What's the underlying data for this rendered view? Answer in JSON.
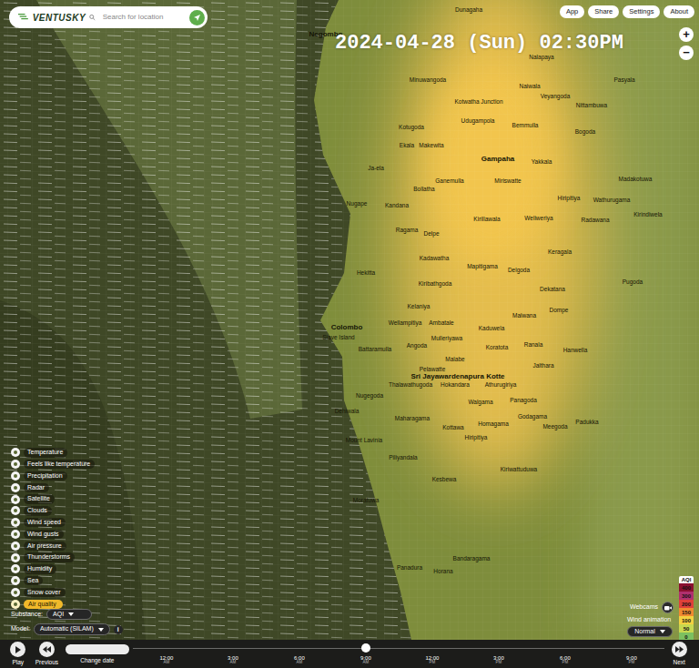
{
  "header": {
    "logo": "VENTUSKY",
    "search": {
      "placeholder": "Search for location"
    }
  },
  "top_buttons": [
    "App",
    "Share",
    "Settings",
    "About"
  ],
  "timestamp": "2024-04-28 (Sun) 02:30PM",
  "zoom": {
    "in": "+",
    "out": "−"
  },
  "places": [
    {
      "name": "Dunagaha",
      "kind": "minor"
    },
    {
      "name": "Negombo",
      "kind": "major"
    },
    {
      "name": "Nalapaya",
      "kind": "minor"
    },
    {
      "name": "Pasyala",
      "kind": "minor"
    },
    {
      "name": "Minuwangoda",
      "kind": "minor"
    },
    {
      "name": "Naiwala",
      "kind": "minor"
    },
    {
      "name": "Veyangoda",
      "kind": "minor"
    },
    {
      "name": "Kotwatha Junction",
      "kind": "minor"
    },
    {
      "name": "Nittambuwa",
      "kind": "minor"
    },
    {
      "name": "Udugampola",
      "kind": "minor"
    },
    {
      "name": "Bemmulla",
      "kind": "minor"
    },
    {
      "name": "Kotugoda",
      "kind": "minor"
    },
    {
      "name": "Bogoda",
      "kind": "minor"
    },
    {
      "name": "Ekala",
      "kind": "minor"
    },
    {
      "name": "Makewita",
      "kind": "minor"
    },
    {
      "name": "Gampaha",
      "kind": "major"
    },
    {
      "name": "Yakkala",
      "kind": "minor"
    },
    {
      "name": "Ja-ela",
      "kind": "minor"
    },
    {
      "name": "Madakotuwa",
      "kind": "minor"
    },
    {
      "name": "Ganemulla",
      "kind": "minor"
    },
    {
      "name": "Miriswatte",
      "kind": "minor"
    },
    {
      "name": "Bollatha",
      "kind": "minor"
    },
    {
      "name": "Hiripitiya",
      "kind": "minor"
    },
    {
      "name": "Wathurugama",
      "kind": "minor"
    },
    {
      "name": "Nugape",
      "kind": "minor"
    },
    {
      "name": "Kandana",
      "kind": "minor"
    },
    {
      "name": "Kirindiwela",
      "kind": "minor"
    },
    {
      "name": "Weliweriya",
      "kind": "minor"
    },
    {
      "name": "Kirillawala",
      "kind": "minor"
    },
    {
      "name": "Radawana",
      "kind": "minor"
    },
    {
      "name": "Ragama",
      "kind": "minor"
    },
    {
      "name": "Delpe",
      "kind": "minor"
    },
    {
      "name": "Keragala",
      "kind": "minor"
    },
    {
      "name": "Kadawatha",
      "kind": "minor"
    },
    {
      "name": "Mapitigama",
      "kind": "minor"
    },
    {
      "name": "Delgoda",
      "kind": "minor"
    },
    {
      "name": "Hekitta",
      "kind": "minor"
    },
    {
      "name": "Pugoda",
      "kind": "minor"
    },
    {
      "name": "Kiribathgoda",
      "kind": "minor"
    },
    {
      "name": "Dekatana",
      "kind": "minor"
    },
    {
      "name": "Kelaniya",
      "kind": "minor"
    },
    {
      "name": "Dompe",
      "kind": "minor"
    },
    {
      "name": "Wellampitiya",
      "kind": "minor"
    },
    {
      "name": "Ambatale",
      "kind": "minor"
    },
    {
      "name": "Colombo",
      "kind": "major"
    },
    {
      "name": "Kaduwela",
      "kind": "minor"
    },
    {
      "name": "Malwana",
      "kind": "minor"
    },
    {
      "name": "Slave Island",
      "kind": "minor"
    },
    {
      "name": "Mulleriyawa",
      "kind": "minor"
    },
    {
      "name": "Ranala",
      "kind": "minor"
    },
    {
      "name": "Koratota",
      "kind": "minor"
    },
    {
      "name": "Angoda",
      "kind": "minor"
    },
    {
      "name": "Battaramulla",
      "kind": "minor"
    },
    {
      "name": "Hanwella",
      "kind": "minor"
    },
    {
      "name": "Malabe",
      "kind": "minor"
    },
    {
      "name": "Jalthara",
      "kind": "minor"
    },
    {
      "name": "Pelawatte",
      "kind": "minor"
    },
    {
      "name": "Sri Jayawardenapura Kotte",
      "kind": "major"
    },
    {
      "name": "Thalawathugoda",
      "kind": "minor"
    },
    {
      "name": "Hokandara",
      "kind": "minor"
    },
    {
      "name": "Athurugiriya",
      "kind": "minor"
    },
    {
      "name": "Nugegoda",
      "kind": "minor"
    },
    {
      "name": "Panagoda",
      "kind": "minor"
    },
    {
      "name": "Walgama",
      "kind": "minor"
    },
    {
      "name": "Dehiwala",
      "kind": "minor"
    },
    {
      "name": "Godagama",
      "kind": "minor"
    },
    {
      "name": "Maharagama",
      "kind": "minor"
    },
    {
      "name": "Padukka",
      "kind": "minor"
    },
    {
      "name": "Homagama",
      "kind": "minor"
    },
    {
      "name": "Meegoda",
      "kind": "minor"
    },
    {
      "name": "Kottawa",
      "kind": "minor"
    },
    {
      "name": "Mount Lavinia",
      "kind": "minor"
    },
    {
      "name": "Hiripitiya",
      "kind": "minor"
    },
    {
      "name": "Piliyandala",
      "kind": "minor"
    },
    {
      "name": "Kiriwattuduwa",
      "kind": "minor"
    },
    {
      "name": "Kesbewa",
      "kind": "minor"
    },
    {
      "name": "Moratuwa",
      "kind": "minor"
    },
    {
      "name": "Bandaragama",
      "kind": "minor"
    },
    {
      "name": "Panadura",
      "kind": "minor"
    },
    {
      "name": "Horana",
      "kind": "minor"
    }
  ],
  "layers": [
    {
      "label": "Temperature",
      "selected": false
    },
    {
      "label": "Feels like temperature",
      "selected": false
    },
    {
      "label": "Precipitation",
      "selected": false
    },
    {
      "label": "Radar",
      "selected": false
    },
    {
      "label": "Satellite",
      "selected": false
    },
    {
      "label": "Clouds",
      "selected": false
    },
    {
      "label": "Wind speed",
      "selected": false
    },
    {
      "label": "Wind gusts",
      "selected": false
    },
    {
      "label": "Air pressure",
      "selected": false
    },
    {
      "label": "Thunderstorms",
      "selected": false
    },
    {
      "label": "Humidity",
      "selected": false
    },
    {
      "label": "Sea",
      "selected": false
    },
    {
      "label": "Snow cover",
      "selected": false
    },
    {
      "label": "Air quality",
      "selected": true
    }
  ],
  "substance": {
    "label": "Substance:",
    "value": "AQI"
  },
  "model": {
    "label": "Model:",
    "value": "Automatic (SILAM)",
    "info": "i"
  },
  "legend": {
    "title": "AQI",
    "items": [
      {
        "label": "400",
        "color": "#8a1030"
      },
      {
        "label": "300",
        "color": "#b0306e"
      },
      {
        "label": "200",
        "color": "#e0403a"
      },
      {
        "label": "150",
        "color": "#f08a30"
      },
      {
        "label": "100",
        "color": "#f4d040"
      },
      {
        "label": "50",
        "color": "#c8d850"
      },
      {
        "label": "0",
        "color": "#7cc060"
      }
    ]
  },
  "webcams": {
    "label": "Webcams"
  },
  "wind_animation": {
    "label": "Wind animation",
    "value": "Normal"
  },
  "timeline": {
    "play": "Play",
    "previous": "Previous",
    "change_date": "Change date",
    "next": "Next",
    "ticks": [
      {
        "time": "12:00",
        "period": "AM"
      },
      {
        "time": "3:00",
        "period": "AM"
      },
      {
        "time": "6:00",
        "period": "AM"
      },
      {
        "time": "9:00",
        "period": "AM"
      },
      {
        "time": "12:00",
        "period": "PM"
      },
      {
        "time": "3:00",
        "period": "PM"
      },
      {
        "time": "6:00",
        "period": "PM"
      },
      {
        "time": "9:00",
        "period": "PM"
      }
    ],
    "level": 0.438
  }
}
